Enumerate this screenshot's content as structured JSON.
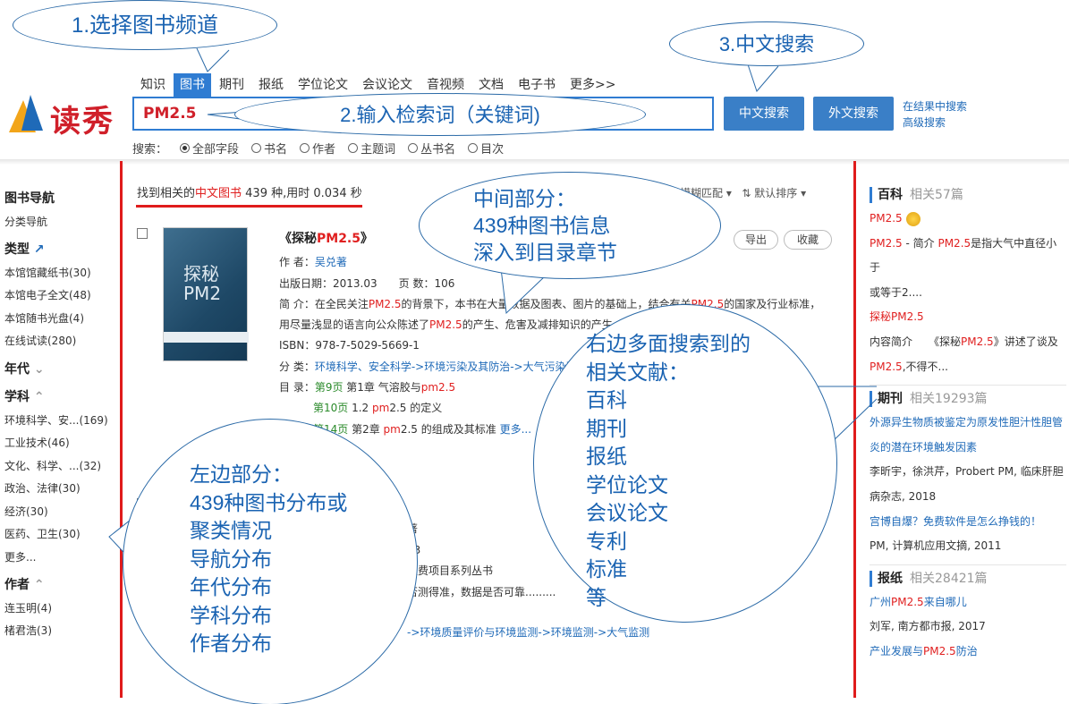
{
  "header": {
    "logo_text": "读秀",
    "channels": [
      "知识",
      "图书",
      "期刊",
      "报纸",
      "学位论文",
      "会议论文",
      "音视频",
      "文档",
      "电子书",
      "更多>>"
    ],
    "active_channel_index": 1,
    "search_value": "PM2.5",
    "btn_cn": "中文搜索",
    "btn_en": "外文搜索",
    "link_in_results": "在结果中搜索",
    "link_advanced": "高级搜索",
    "scope_label": "搜索：",
    "scope_options": [
      "全部字段",
      "书名",
      "作者",
      "主题词",
      "丛书名",
      "目次"
    ],
    "scope_selected_index": 0
  },
  "left_nav": {
    "nav_title": "图书导航",
    "nav_sub": "分类导航",
    "type_title": "类型",
    "type_items": [
      "本馆馆藏纸书(30)",
      "本馆电子全文(48)",
      "本馆随书光盘(4)",
      "在线试读(280)"
    ],
    "year_title": "年代",
    "subject_title": "学科",
    "subject_items": [
      "环境科学、安...(169)",
      "工业技术(46)",
      "文化、科学、...(32)",
      "政治、法律(30)",
      "经济(30)",
      "医药、卫生(30)",
      "更多..."
    ],
    "author_title": "作者",
    "author_items": [
      "连玉明(4)",
      "楮君浩(3)"
    ]
  },
  "results": {
    "found_prefix": "找到相关的",
    "found_channel": "中文图书",
    "found_suffix": " 439 种,用时 0.034 秒",
    "match_mode": "模糊匹配",
    "sort_label": "默认排序",
    "book1": {
      "cover_text": "探秘 PM2",
      "title_prefix": "《探秘",
      "title_hl": "PM2.5",
      "title_suffix": "》",
      "author_label": "作 者：",
      "author": "吴兑著",
      "date_line": "出版日期：2013.03　　页 数：106",
      "intro_a": "简 介：在全民关注",
      "intro_b": "PM2.5",
      "intro_c": "的背景下，本书在大量",
      "intro_d": "数据及图表、图片的基础上，结合有关",
      "intro_e": "PM2.5",
      "intro_f": "的国家及行业标准，",
      "intro2_a": "用尽量浅显的语言向公众陈述了",
      "intro2_b": "PM2.5",
      "intro2_c": "的产生、危害及减排知识的产生、危害",
      "isbn": "ISBN：978-7-5029-5669-1",
      "class_label": "分 类：",
      "class_value": "环境科学、安全科学->环境污染及其防治->大气污染及",
      "toc_label": "目 录：",
      "toc1_page": "第9页",
      "toc1_text": " 第1章 气溶胶与",
      "toc1_hl": "pm2.5",
      "toc2_page": "第10页",
      "toc2_text": " 1.2 ",
      "toc2_hl": "pm",
      "toc2_text2": "2.5 的定义",
      "toc3_page": "第14页",
      "toc3_text": " 第2章 ",
      "toc3_hl": "pm",
      "toc3_text2": "2.5 的组成及其标准 ",
      "toc3_more": "更多...",
      "export": "导出",
      "collect": "收藏"
    },
    "book2": {
      "line1": "著",
      "line2": "43",
      "line3": "经费项目系列丛书",
      "line4": "否测得准，数据是否可靠.........",
      "class_value": "->环境质量评价与环境监测->环境监测->大气监测"
    }
  },
  "right_pane": {
    "baike_title": "百科",
    "baike_count": "相关57篇",
    "baike_items": [
      {
        "hl": "PM2.5",
        "rest": ""
      },
      {
        "hl": "PM2.5",
        "rest": " - 简介 ",
        "hl2": "PM2.5",
        "rest2": "是指大气中直径小于"
      },
      {
        "plain": "或等于2...."
      },
      {
        "plain_hl": "探秘",
        "hl": "PM2.5"
      }
    ],
    "baike_intro": "内容简介　　《探秘",
    "baike_intro_hl": "PM2.5",
    "baike_intro_rest": "》讲述了谈及",
    "baike_last_hl": "PM2.5",
    "baike_last_rest": ",不得不...",
    "journal_title": "期刊",
    "journal_count": "相关19293篇",
    "journal_item1_a": "外源异生物质被鉴定为原发性胆汁性胆管",
    "journal_item1_b": "炎的潜在环境触发因素",
    "journal_item1_meta": "李昕宇，徐洪芹，Probert PM, 临床肝胆",
    "journal_item1_meta2": "病杂志, 2018",
    "journal_item2": "宫博自爆？免费软件是怎么挣钱的！",
    "journal_item2_meta": "PM, 计算机应用文摘, 2011",
    "news_title": "报纸",
    "news_count": "相关28421篇",
    "news_item1_a": "广州",
    "news_item1_hl": "PM2.5",
    "news_item1_b": "来自哪儿",
    "news_item1_meta": "刘军, 南方都市报, 2017",
    "news_item2_a": "产业发展与",
    "news_item2_hl": "PM2.5",
    "news_item2_b": "防治"
  },
  "callouts": {
    "c1": "1.选择图书频道",
    "c2": "2.输入检索词（关键词)",
    "c3": "3.中文搜索",
    "mid": [
      "中间部分：",
      "439种图书信息",
      "深入到目录章节"
    ],
    "left": [
      "左边部分：",
      "439种图书分布或",
      "聚类情况",
      "导航分布",
      "年代分布",
      "学科分布",
      "作者分布"
    ],
    "right": [
      "右边多面搜索到的",
      "相关文献：",
      "百科",
      "期刊",
      "报纸",
      "学位论文",
      "会议论文",
      "专利",
      "标准",
      "等"
    ]
  }
}
